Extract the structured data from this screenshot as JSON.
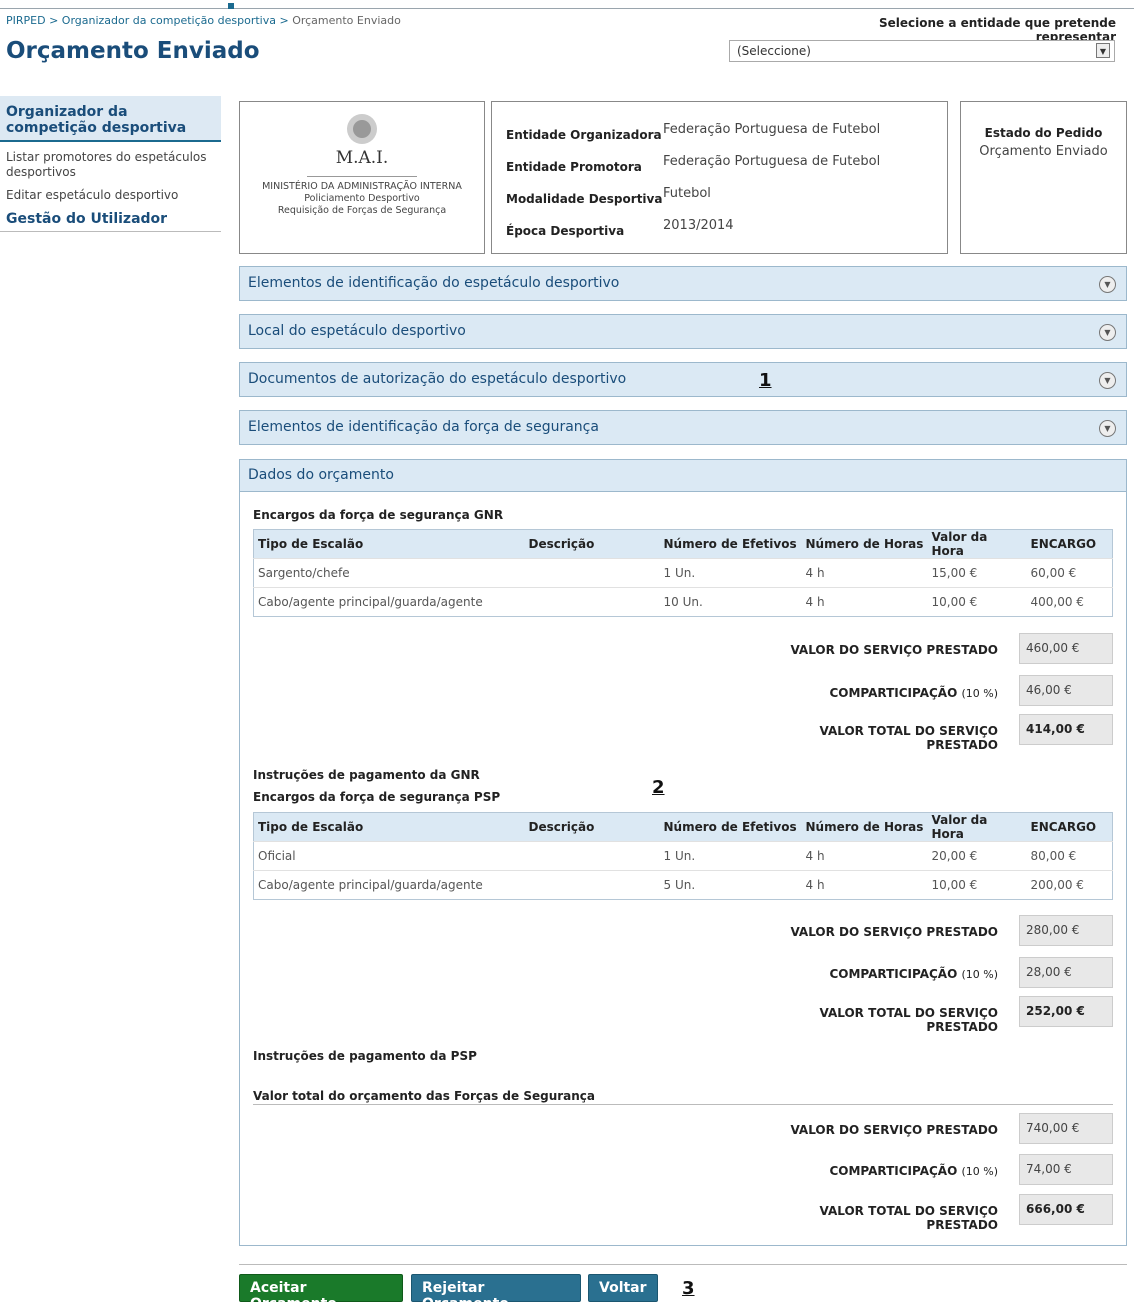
{
  "breadcrumb": {
    "root": "PIRPED",
    "sep": ">",
    "parent": "Organizador da competição desportiva",
    "current": "Orçamento Enviado"
  },
  "page_title": "Orçamento Enviado",
  "entity": {
    "label": "Selecione a entidade que pretende representar",
    "value": "(Seleccione)"
  },
  "sidebar": {
    "selected": "Organizador da competição desportiva",
    "items": [
      "Listar promotores do espetáculos desportivos",
      "Editar espetáculo desportivo"
    ],
    "section": "Gestão do Utilizador"
  },
  "logo": {
    "title": "M.A.I.",
    "line1": "MINISTÉRIO DA ADMINISTRAÇÃO INTERNA",
    "line2": "Policiamento Desportivo",
    "line3": "Requisição de Forças de Segurança"
  },
  "info": {
    "rows": [
      {
        "k": "Entidade Organizadora",
        "v": "Federação Portuguesa de Futebol"
      },
      {
        "k": "Entidade Promotora",
        "v": "Federação Portuguesa de Futebol"
      },
      {
        "k": "Modalidade Desportiva",
        "v": "Futebol"
      },
      {
        "k": "Época Desportiva",
        "v": "2013/2014"
      }
    ]
  },
  "state": {
    "k": "Estado do Pedido",
    "v": "Orçamento Enviado"
  },
  "accordions": [
    "Elementos de identificação do espetáculo desportivo",
    "Local do espetáculo desportivo",
    "Documentos de autorização do espetáculo desportivo",
    "Elementos de identificação da força de segurança"
  ],
  "main_title": "Dados do orçamento",
  "columns": [
    "Tipo de Escalão",
    "Descrição",
    "Número de Efetivos",
    "Número de Horas",
    "Valor da Hora",
    "ENCARGO"
  ],
  "gnr": {
    "title": "Encargos da força de segurança GNR",
    "rows": [
      [
        "Sargento/chefe",
        "",
        "1 Un.",
        "4 h",
        "15,00 €",
        "60,00 €"
      ],
      [
        "Cabo/agente principal/guarda/agente",
        "",
        "10 Un.",
        "4 h",
        "10,00 €",
        "400,00 €"
      ]
    ],
    "servico": "460,00 €",
    "compart": "46,00 €",
    "total": "414,00 €",
    "instr": "Instruções de pagamento da GNR"
  },
  "psp": {
    "title": "Encargos da força de segurança PSP",
    "rows": [
      [
        "Oficial",
        "",
        "1 Un.",
        "4 h",
        "20,00 €",
        "80,00 €"
      ],
      [
        "Cabo/agente principal/guarda/agente",
        "",
        "5 Un.",
        "4 h",
        "10,00 €",
        "200,00 €"
      ]
    ],
    "servico": "280,00 €",
    "compart": "28,00 €",
    "total": "252,00 €",
    "instr": "Instruções de pagamento da PSP"
  },
  "totais": {
    "title": "Valor total do orçamento das Forças de Segurança",
    "servico": "740,00 €",
    "compart": "74,00 €",
    "total": "666,00 €"
  },
  "labels": {
    "servico": "VALOR DO SERVIÇO PRESTADO",
    "compart": "COMPARTICIPAÇÃO",
    "pct": "(10 %)",
    "total": "VALOR TOTAL DO SERVIÇO PRESTADO"
  },
  "buttons": {
    "accept": "Aceitar Orçamento",
    "reject": "Rejeitar Orçamento",
    "back": "Voltar"
  },
  "annotations": [
    "1",
    "2",
    "3"
  ]
}
